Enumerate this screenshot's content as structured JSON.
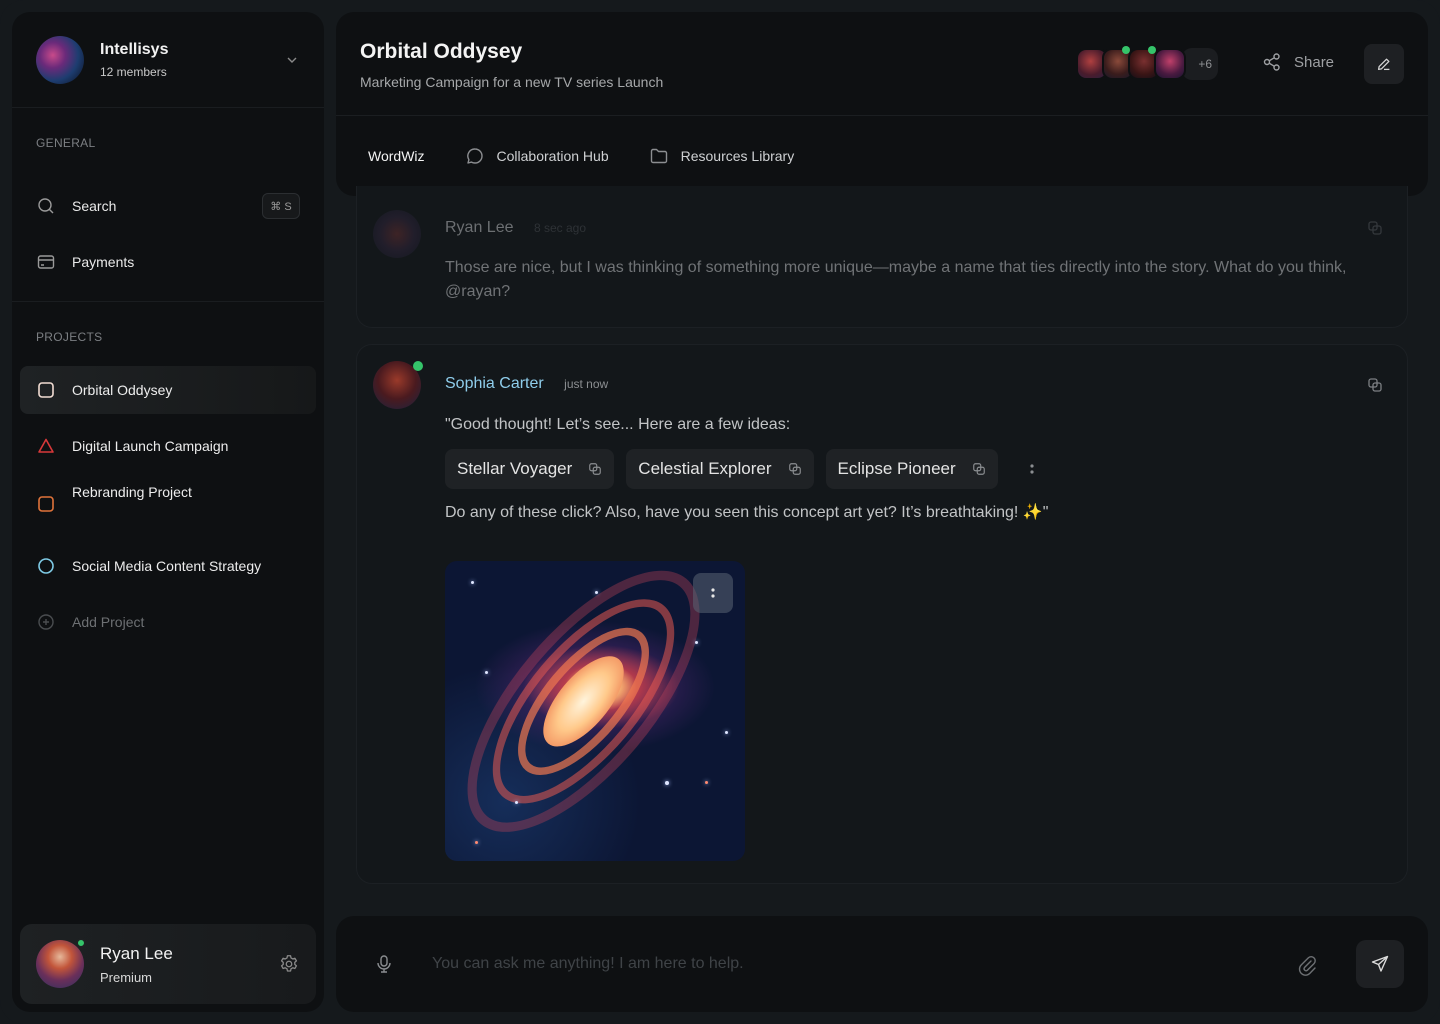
{
  "workspace": {
    "name": "Intellisys",
    "members": "12 members"
  },
  "sidebar": {
    "general_label": "GENERAL",
    "general_items": [
      {
        "label": "Search",
        "icon": "search-icon",
        "shortcut": "⌘ S"
      },
      {
        "label": "Payments",
        "icon": "card-icon"
      }
    ],
    "projects_label": "PROJECTS",
    "projects": [
      {
        "label": "Orbital Oddysey",
        "icon": "square-icon",
        "color": "#f2ddd3",
        "active": true
      },
      {
        "label": "Digital Launch Campaign",
        "icon": "triangle-icon",
        "color": "#d8383a"
      },
      {
        "label": "Rebranding Project",
        "icon": "square-icon",
        "color": "#e0733a"
      },
      {
        "label": "Social Media Content Strategy",
        "icon": "circle-icon",
        "color": "#7fcbe6"
      }
    ],
    "add_project_label": "Add Project"
  },
  "user": {
    "name": "Ryan Lee",
    "plan": "Premium",
    "status": "online"
  },
  "header": {
    "title": "Orbital Oddysey",
    "subtitle": "Marketing Campaign for a new TV series Launch",
    "collaborators_extra": "+6",
    "share_label": "Share",
    "tabs": [
      {
        "label": "WordWiz",
        "active": true
      },
      {
        "label": "Collaboration Hub",
        "icon": "chat-bubble-icon"
      },
      {
        "label": "Resources Library",
        "icon": "folder-icon"
      }
    ]
  },
  "messages": [
    {
      "author": "Ryan Lee",
      "time": "8 sec ago",
      "text": "Those are nice, but I was thinking of something more unique—maybe a name that ties directly into the story. What do you think, @rayan?"
    },
    {
      "author": "Sophia Carter",
      "time": "just now",
      "intro": "\"Good thought! Let’s see... Here are a few ideas:",
      "suggestions": [
        "Stellar Voyager",
        "Celestial Explorer",
        "Eclipse Pioneer"
      ],
      "outro": "Do any of these click? Also, have you seen this concept art yet? It’s breathtaking! ✨\"",
      "attachment": "galaxy concept art"
    }
  ],
  "composer": {
    "placeholder": "You can ask me anything! I am here to help.",
    "value": ""
  },
  "colors": {
    "accent_tab": "#ffe4d9",
    "author_highlight": "#8fcdeb",
    "online": "#35c46a"
  }
}
